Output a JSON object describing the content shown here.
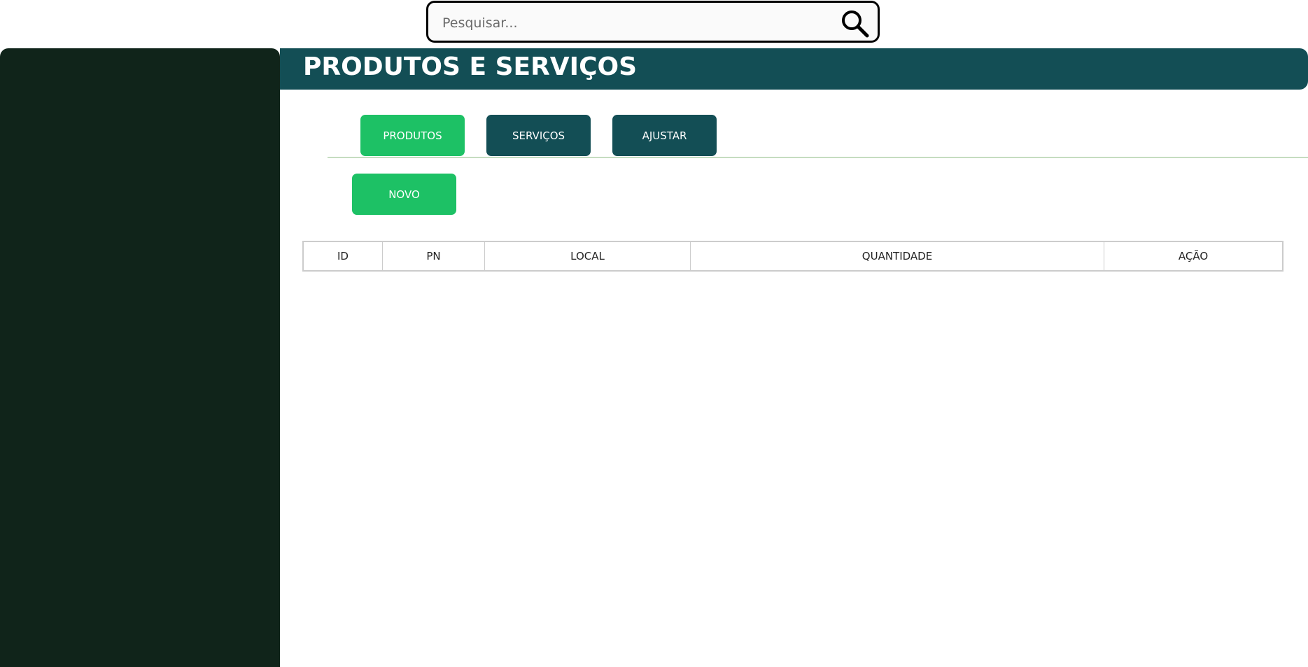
{
  "search": {
    "placeholder": "Pesquisar...",
    "value": "",
    "icon": "search-icon"
  },
  "header": {
    "title": "PRODUTOS E SERVIÇOS"
  },
  "tabs": [
    {
      "label": "PRODUTOS",
      "active": true
    },
    {
      "label": "SERVIÇOS",
      "active": false
    },
    {
      "label": "AJUSTAR",
      "active": false
    }
  ],
  "actions": {
    "new_label": "NOVO"
  },
  "table": {
    "columns": [
      "ID",
      "PN",
      "LOCAL",
      "QUANTIDADE",
      "AÇÃO"
    ],
    "rows": []
  },
  "colors": {
    "accent": "#1dc165",
    "primary": "#134e55",
    "sidebar": "#10241a"
  }
}
